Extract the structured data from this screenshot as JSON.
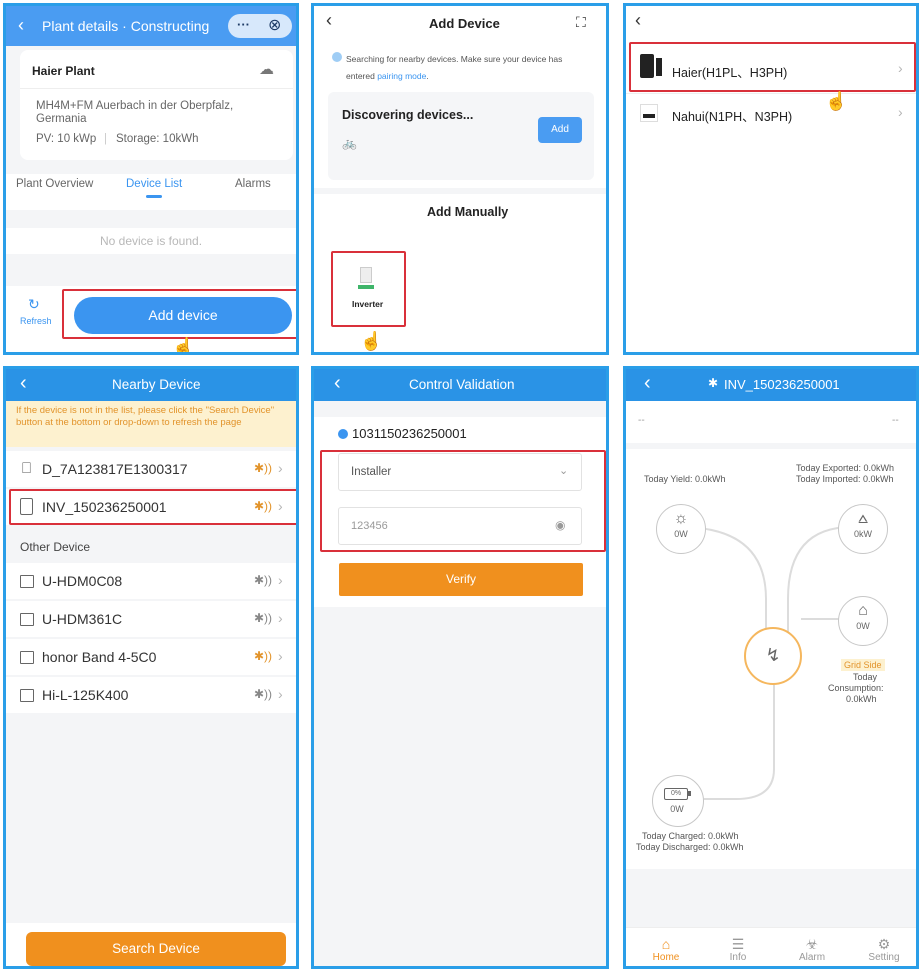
{
  "p1": {
    "title": "Plant details · Constructing",
    "more": "···",
    "close": "⊗",
    "plant_name": "Haier Plant",
    "weather_icon": "cloud-icon",
    "address": "MH4M+FM Auerbach in der Oberpfalz, Germania",
    "pv": "PV: 10 kWp",
    "sep": "|",
    "storage": "Storage: 10kWh",
    "tabs": [
      "Plant Overview",
      "Device List",
      "Alarms"
    ],
    "empty": "No device is found.",
    "refresh": "Refresh",
    "add": "Add device"
  },
  "p2": {
    "title": "Add Device",
    "search_prefix": "Searching for nearby devices. Make sure your device has entered ",
    "search_link": "pairing mode",
    "search_suffix": ".",
    "discover": "Discovering devices...",
    "add": "Add",
    "manual": "Add Manually",
    "inverter": "Inverter",
    "accent": "#3b95f0"
  },
  "p3": {
    "items": [
      "Haier(H1PL、H3PH)",
      "Nahui(N1PH、N3PH)"
    ]
  },
  "p4": {
    "title": "Nearby Device",
    "notice": "If the device is not in the list, please click the \"Search Device\" button at the bottom or drop-down to refresh the page",
    "nearby": [
      "D_7A123817E1300317",
      "INV_150236250001"
    ],
    "other_header": "Other Device",
    "other": [
      "U-HDM0C08",
      "U-HDM361C",
      "honor Band 4-5C0",
      "Hi-L-125K400"
    ],
    "search": "Search Device",
    "accent": "#f0901e"
  },
  "p5": {
    "title": "Control Validation",
    "serial": "1031150236250001",
    "role": "Installer",
    "password": "123456",
    "verify": "Verify"
  },
  "p6": {
    "title": "INV_150236250001",
    "dash_left": "--",
    "dash_right": "--",
    "yield": "Today Yield: 0.0kWh",
    "exported": "Today Exported: 0.0kWh",
    "imported": "Today Imported: 0.0kWh",
    "pv_val": "0W",
    "grid_val": "0kW",
    "load_val": "0W",
    "grid_side": "Grid Side",
    "today": "Today",
    "consumption": "Consumption:",
    "consumption_val": "0.0kWh",
    "battery_pct": "0%",
    "battery_val": "0W",
    "charged": "Today Charged: 0.0kWh",
    "discharged": "Today Discharged: 0.0kWh",
    "nav": [
      "Home",
      "Info",
      "Alarm",
      "Setting"
    ]
  }
}
